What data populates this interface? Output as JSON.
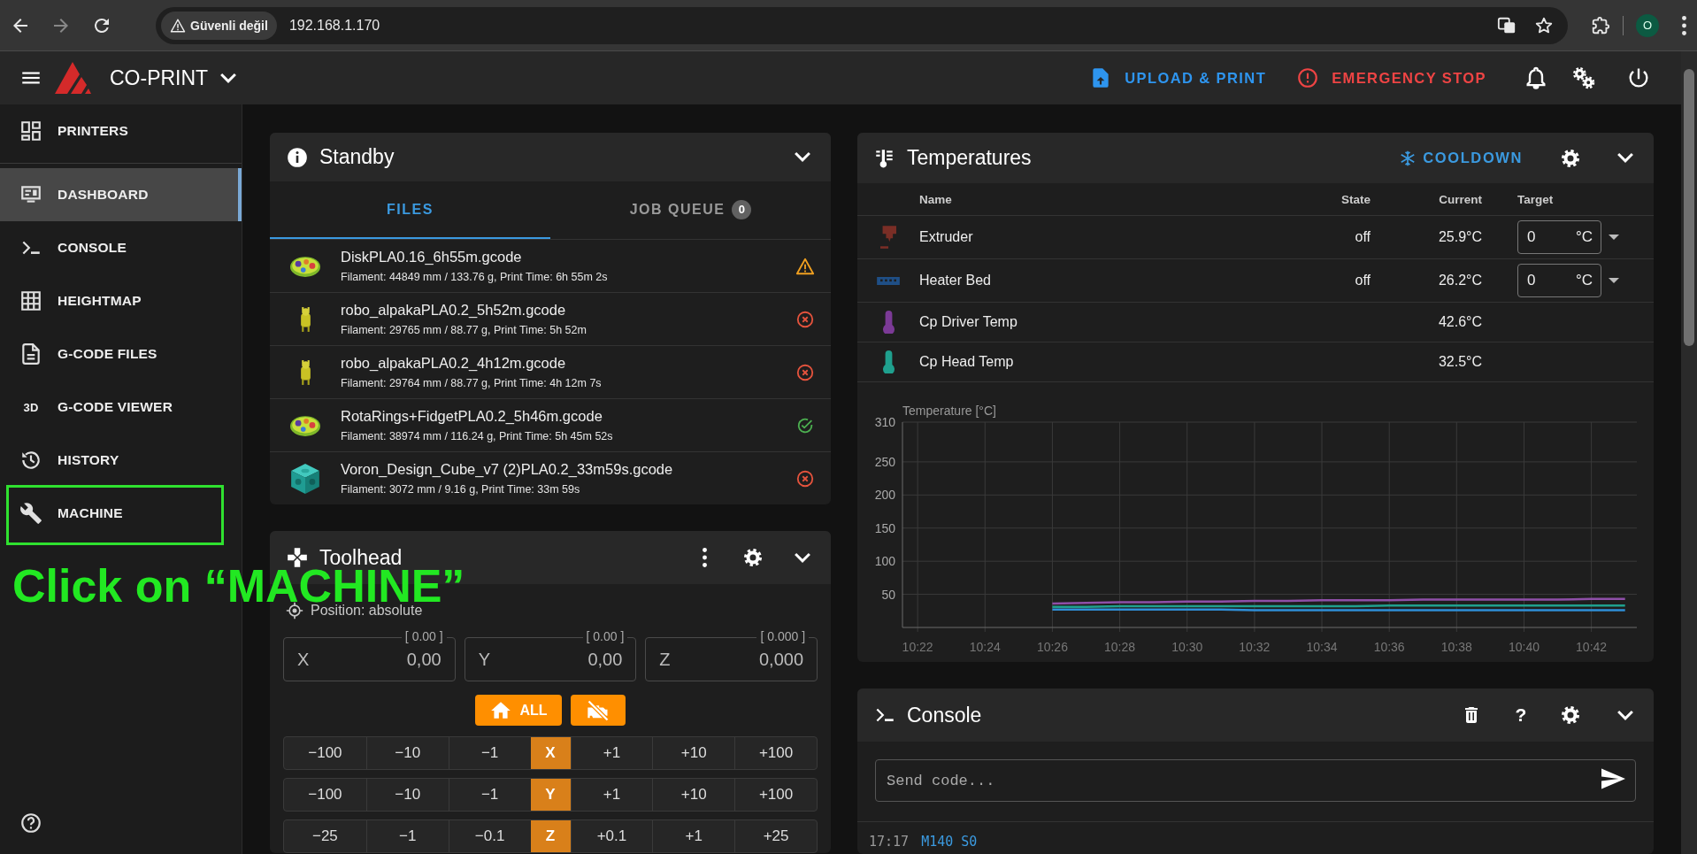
{
  "browser": {
    "security_label": "Güvenli değil",
    "url": "192.168.1.170",
    "profile_initial": "O"
  },
  "app_bar": {
    "title": "CO-PRINT",
    "actions": [
      {
        "kind": "upload",
        "label": "UPLOAD & PRINT"
      },
      {
        "kind": "stop",
        "label": "EMERGENCY STOP"
      }
    ]
  },
  "sidebar": {
    "items": [
      {
        "kind": "printers",
        "label": "PRINTERS",
        "selected": false,
        "highlighted": false
      },
      {
        "kind": "dashboard",
        "label": "DASHBOARD",
        "selected": true,
        "highlighted": false
      },
      {
        "kind": "console",
        "label": "CONSOLE",
        "selected": false,
        "highlighted": false
      },
      {
        "kind": "heightmap",
        "label": "HEIGHTMAP",
        "selected": false,
        "highlighted": false
      },
      {
        "kind": "files",
        "label": "G-CODE FILES",
        "selected": false,
        "highlighted": false
      },
      {
        "kind": "viewer",
        "icon_text": "3D",
        "label": "G-CODE VIEWER",
        "selected": false,
        "highlighted": false
      },
      {
        "kind": "history",
        "label": "HISTORY",
        "selected": false,
        "highlighted": false
      },
      {
        "kind": "machine",
        "label": "MACHINE",
        "selected": false,
        "highlighted": true
      }
    ]
  },
  "annotation": {
    "text": "Click on “MACHINE”"
  },
  "standby": {
    "title": "Standby",
    "tabs": [
      {
        "label": "FILES",
        "selected": true
      },
      {
        "label": "JOB QUEUE",
        "count": "0",
        "selected": false
      }
    ],
    "files": [
      {
        "name": "DiskPLA0.16_6h55m.gcode",
        "details": "Filament: 44849 mm / 133.76 g, Print Time: 6h 55m 2s",
        "kind": "warning"
      },
      {
        "name": "robo_alpakaPLA0.2_5h52m.gcode",
        "details": "Filament: 29765 mm / 88.77 g, Print Time: 5h 52m",
        "kind": "error"
      },
      {
        "name": "robo_alpakaPLA0.2_4h12m.gcode",
        "details": "Filament: 29764 mm / 88.77 g, Print Time: 4h 12m 7s",
        "kind": "error"
      },
      {
        "name": "RotaRings+FidgetPLA0.2_5h46m.gcode",
        "details": "Filament: 38974 mm / 116.24 g, Print Time: 5h 45m 52s",
        "kind": "ok"
      },
      {
        "name": "Voron_Design_Cube_v7 (2)PLA0.2_33m59s.gcode",
        "details": "Filament: 3072 mm / 9.16 g, Print Time: 33m 59s",
        "kind": "error"
      }
    ]
  },
  "toolhead": {
    "title": "Toolhead",
    "position_mode": "Position: absolute",
    "axes": [
      {
        "label": "X",
        "reading": "[ 0.00 ]",
        "value": "0,00"
      },
      {
        "label": "Y",
        "reading": "[ 0.00 ]",
        "value": "0,00"
      },
      {
        "label": "Z",
        "reading": "[ 0.000 ]",
        "value": "0,000"
      }
    ],
    "home_label": "ALL",
    "jog_rows": [
      {
        "axis": "X",
        "steps": [
          "−100",
          "−10",
          "−1",
          "+1",
          "+10",
          "+100"
        ]
      },
      {
        "axis": "Y",
        "steps": [
          "−100",
          "−10",
          "−1",
          "+1",
          "+10",
          "+100"
        ]
      },
      {
        "axis": "Z",
        "steps": [
          "−25",
          "−1",
          "−0.1",
          "+0.1",
          "+1",
          "+25"
        ]
      }
    ]
  },
  "temperatures": {
    "title": "Temperatures",
    "cooldown_label": "COOLDOWN",
    "columns": [
      "Name",
      "State",
      "Current",
      "Target"
    ],
    "rows": [
      {
        "kind": "extruder",
        "color": "#7a2e26",
        "name": "Extruder",
        "state": "off",
        "current": "25.9°C",
        "target": "0",
        "unit": "°C"
      },
      {
        "kind": "bed",
        "color": "#1f4f86",
        "name": "Heater Bed",
        "state": "off",
        "current": "26.2°C",
        "target": "0",
        "unit": "°C"
      },
      {
        "kind": "sensor",
        "color": "#7b3a96",
        "name": "Cp Driver Temp",
        "current": "42.6°C"
      },
      {
        "kind": "sensor",
        "color": "#1fa08e",
        "name": "Cp Head Temp",
        "current": "32.5°C"
      }
    ],
    "chart_data": {
      "type": "line",
      "ylabel": "Temperature [°C]",
      "categories": [
        "10:22",
        null,
        "10:24",
        null,
        "10:26",
        null,
        "10:28",
        null,
        "10:30",
        null,
        "10:32",
        null,
        "10:34",
        null,
        "10:36",
        null,
        "10:38",
        null,
        "10:40",
        null,
        "10:42",
        null
      ],
      "ylim": [
        0,
        310
      ],
      "yticks": [
        50,
        100,
        150,
        200,
        250,
        310
      ],
      "grid": true,
      "series": [
        {
          "color": "#8e4fa8",
          "values": [
            null,
            null,
            null,
            null,
            36,
            37,
            38,
            38,
            39,
            39,
            40,
            40,
            41,
            41,
            41,
            42,
            42,
            42,
            42,
            42,
            43,
            43
          ]
        },
        {
          "color": "#1fa08e",
          "values": [
            null,
            null,
            null,
            null,
            31,
            31,
            32,
            32,
            32,
            32,
            32,
            32,
            32,
            32,
            33,
            33,
            33,
            33,
            33,
            33,
            33,
            33
          ]
        },
        {
          "color": "#2f8fd8",
          "values": [
            null,
            null,
            null,
            null,
            27,
            27,
            27,
            27,
            27,
            27,
            26,
            26,
            26,
            26,
            26,
            26,
            26,
            26,
            26,
            26,
            26,
            26
          ]
        }
      ]
    }
  },
  "console": {
    "title": "Console",
    "help_label": "?",
    "placeholder": "Send code...",
    "entries": [
      {
        "time": "17:17",
        "command": "M140 S0"
      }
    ]
  }
}
